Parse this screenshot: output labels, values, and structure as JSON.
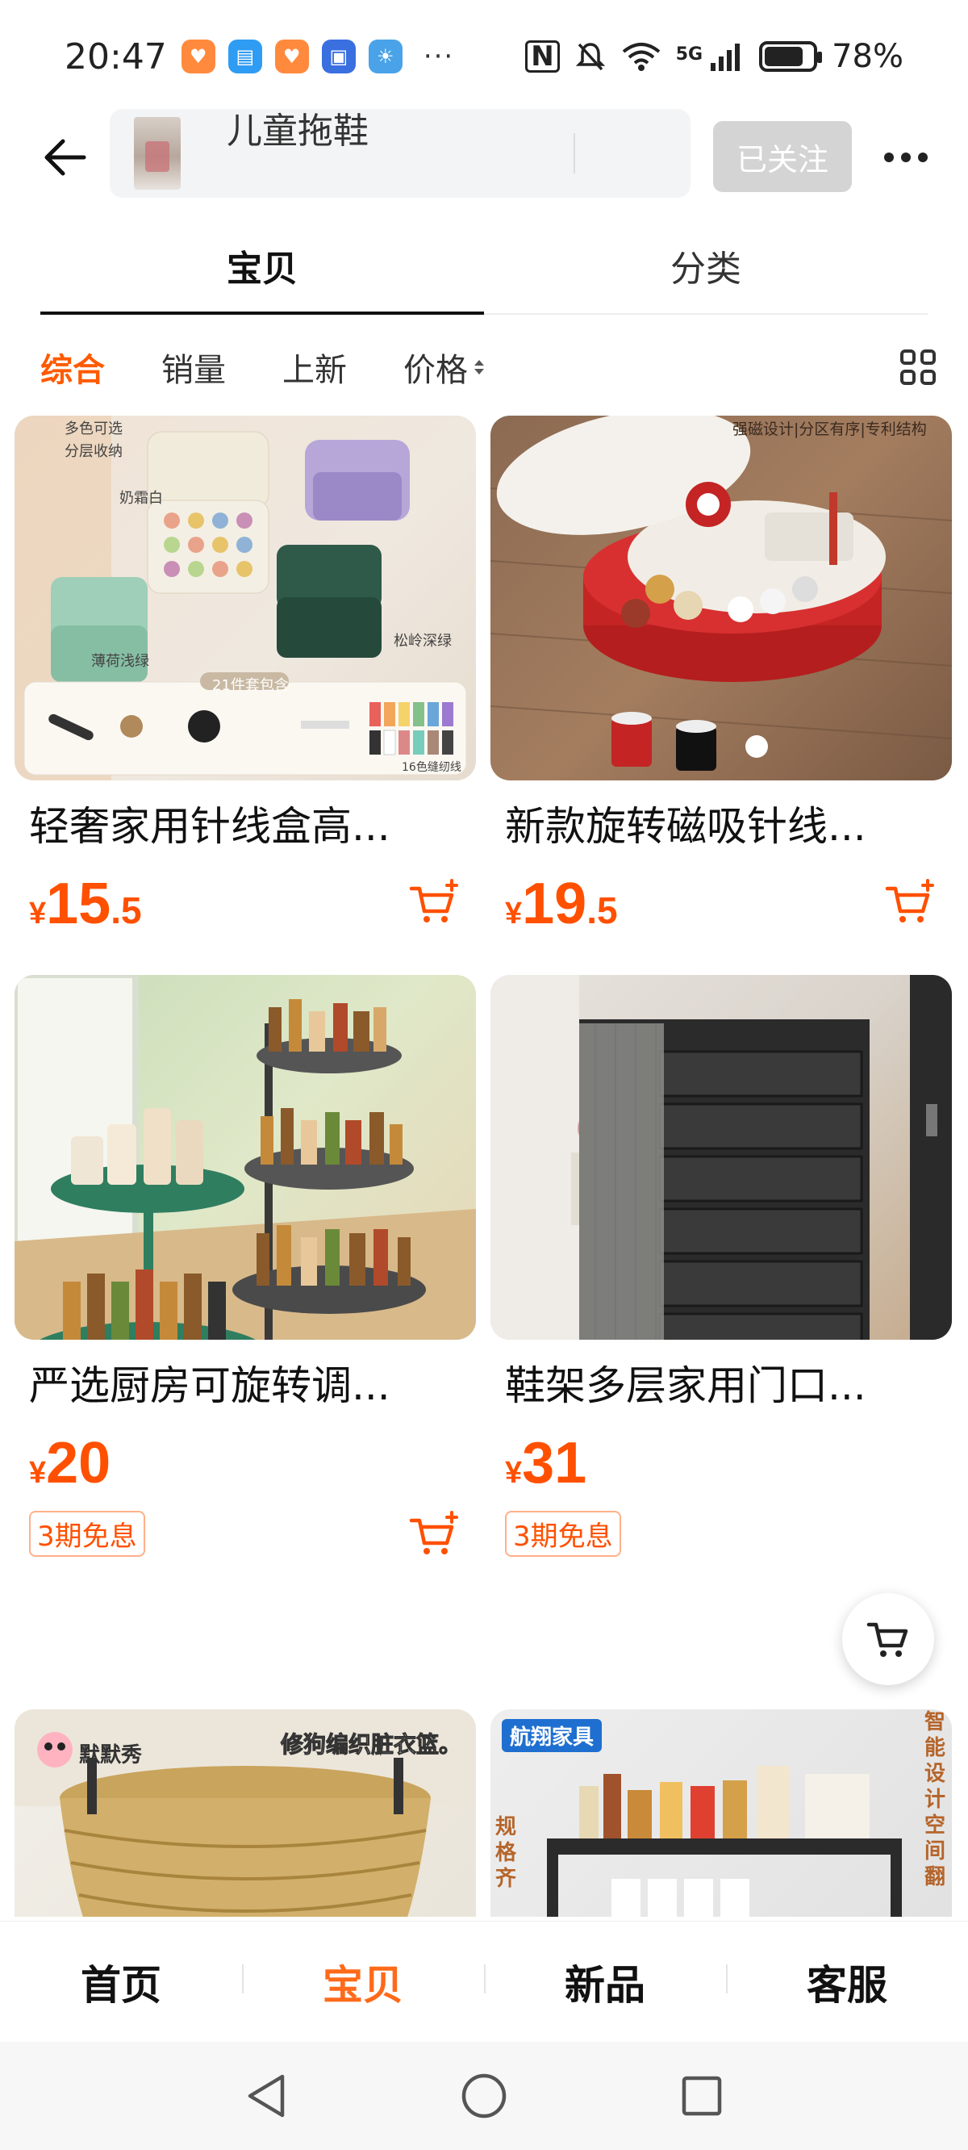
{
  "status_bar": {
    "time": "20:47",
    "more": "···",
    "network": "5G",
    "battery": "78%",
    "battery_level": 0.78
  },
  "header": {
    "search_text": "儿童拖鞋",
    "follow_label": "已关注"
  },
  "tabs": [
    {
      "label": "宝贝",
      "active": true
    },
    {
      "label": "分类",
      "active": false
    }
  ],
  "sort": {
    "items": [
      "综合",
      "销量",
      "上新",
      "价格"
    ],
    "active": "综合"
  },
  "products": [
    {
      "title": "轻奢家用针线盒高...",
      "price_symbol": "¥",
      "price_int": "15",
      "price_dec": ".5",
      "image_texts": [
        "多色可选",
        "分层收纳",
        "奶霜白",
        "薄荷浅绿",
        "松岭深绿",
        "21件套包含",
        "16色缝纫线"
      ]
    },
    {
      "title": "新款旋转磁吸针线...",
      "price_symbol": "¥",
      "price_int": "19",
      "price_dec": ".5",
      "image_texts": [
        "强磁设计|分区有序|专利结构"
      ]
    },
    {
      "title": "严选厨房可旋转调...",
      "price_symbol": "¥",
      "price_int": "20",
      "price_dec": "",
      "badge": "3期免息"
    },
    {
      "title": "鞋架多层家用门口...",
      "price_symbol": "¥",
      "price_int": "31",
      "price_dec": "",
      "badge": "3期免息"
    },
    {
      "image_texts": [
        "默默秀",
        "修狗编织脏衣篮。"
      ]
    },
    {
      "image_texts": [
        "航翔家具",
        "规格齐",
        "智能设计空间翻"
      ]
    }
  ],
  "shop_nav": [
    {
      "label": "首页",
      "active": false
    },
    {
      "label": "宝贝",
      "active": true
    },
    {
      "label": "新品",
      "active": false
    },
    {
      "label": "客服",
      "active": false
    }
  ],
  "colors": {
    "accent": "#ff5000",
    "nav_active": "#ff6a1a",
    "follow_bg": "#d4d4d4"
  }
}
